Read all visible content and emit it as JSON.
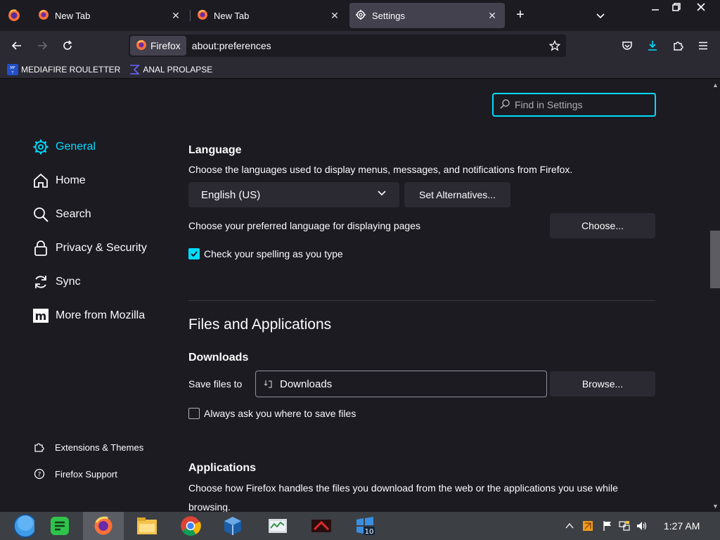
{
  "tabs": [
    {
      "title": "New Tab",
      "active": false
    },
    {
      "title": "New Tab",
      "active": false
    },
    {
      "title": "Settings",
      "active": true
    }
  ],
  "urlbar": {
    "identity_label": "Firefox",
    "url": "about:preferences"
  },
  "bookmarks": [
    {
      "label": "MEDIAFIRE ROULETTER",
      "icon": "mediafire-icon"
    },
    {
      "label": "ANAL PROLAPSE",
      "icon": "sigma-icon"
    }
  ],
  "search": {
    "placeholder": "Find in Settings"
  },
  "categories": [
    {
      "label": "General",
      "icon": "gear-icon",
      "selected": true
    },
    {
      "label": "Home",
      "icon": "home-icon",
      "selected": false
    },
    {
      "label": "Search",
      "icon": "search-icon",
      "selected": false
    },
    {
      "label": "Privacy & Security",
      "icon": "lock-icon",
      "selected": false
    },
    {
      "label": "Sync",
      "icon": "sync-icon",
      "selected": false
    },
    {
      "label": "More from Mozilla",
      "icon": "mozilla-icon",
      "selected": false
    }
  ],
  "footer_links": [
    {
      "label": "Extensions & Themes",
      "icon": "puzzle-icon"
    },
    {
      "label": "Firefox Support",
      "icon": "help-icon"
    }
  ],
  "language": {
    "heading": "Language",
    "description": "Choose the languages used to display menus, messages, and notifications from Firefox.",
    "selected": "English (US)",
    "alternatives_button": "Set Alternatives...",
    "page_lang_label": "Choose your preferred language for displaying pages",
    "choose_button": "Choose...",
    "spellcheck_label": "Check your spelling as you type",
    "spellcheck_checked": true
  },
  "files_apps": {
    "heading": "Files and Applications",
    "downloads_heading": "Downloads",
    "save_to_label": "Save files to",
    "save_path": "Downloads",
    "browse_button": "Browse...",
    "always_ask_label": "Always ask you where to save files",
    "always_ask_checked": false,
    "applications_heading": "Applications",
    "applications_description": "Choose how Firefox handles the files you download from the web or the applications you use while",
    "applications_description_2": "browsing."
  },
  "taskbar": {
    "clock": "1:27 AM",
    "apps": [
      "start-orb",
      "notes-app",
      "firefox",
      "file-explorer",
      "chrome",
      "virtualbox",
      "task-manager",
      "game-app",
      "windows10-app"
    ]
  },
  "colors": {
    "accent": "#00ddff",
    "background": "#1c1b22",
    "toolbar": "#2b2a33"
  }
}
